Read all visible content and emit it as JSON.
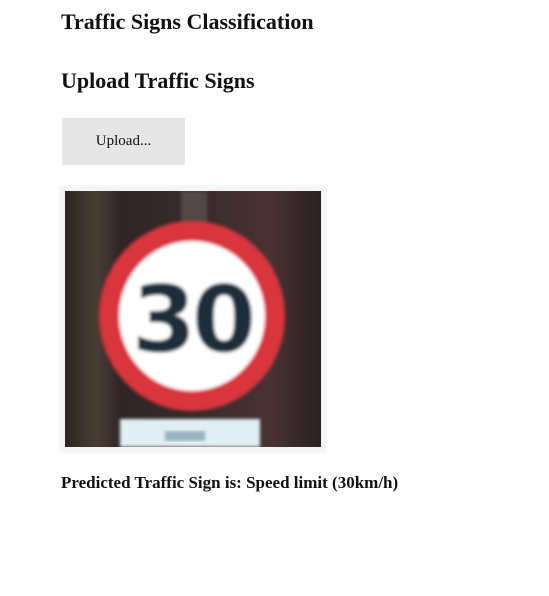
{
  "page": {
    "title": "Traffic Signs Classification",
    "subtitle": "Upload Traffic Signs"
  },
  "upload": {
    "button_label": "Upload..."
  },
  "preview": {
    "sign_text": "30",
    "colors": {
      "ring": "#d8363c",
      "face": "#ffffff",
      "digits": "#1f2f3a",
      "background": "#3a2b2b",
      "plate": "#dfeff4"
    }
  },
  "result": {
    "prediction_text": "Predicted Traffic Sign is: Speed limit (30km/h)"
  }
}
